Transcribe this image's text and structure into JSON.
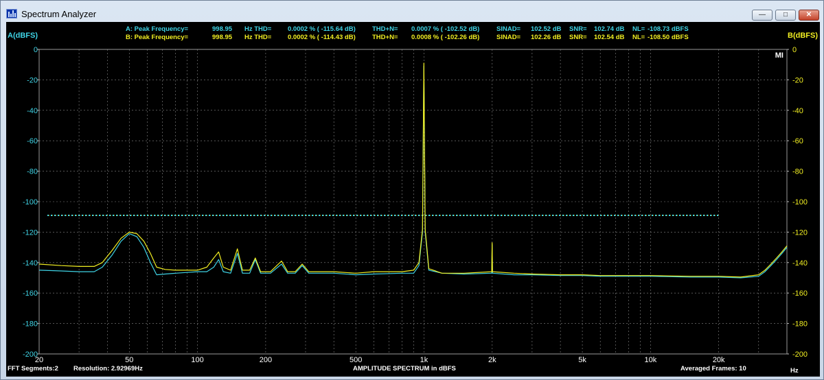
{
  "window": {
    "title": "Spectrum Analyzer"
  },
  "titlebar_buttons": {
    "minimize": "—",
    "restore": "□",
    "close": "✕"
  },
  "colors": {
    "channel_a": "#3fd4e6",
    "channel_b": "#f2ef22",
    "background": "#000000",
    "grid": "#8a8a8a"
  },
  "header": {
    "a": {
      "label": "A: Peak Frequency=",
      "freq": "998.95",
      "thd_label": "Hz  THD=",
      "thd": "0.0002 % ( -115.64 dB)",
      "thdn_label": "THD+N=",
      "thdn": "0.0007 % ( -102.52 dB)",
      "sinad_label": "SINAD=",
      "sinad": "102.52 dB",
      "snr_label": "SNR=",
      "snr": "102.74 dB",
      "nl_label": "NL=",
      "nl": "-108.73 dBFS"
    },
    "b": {
      "label": "B: Peak Frequency=",
      "freq": "998.95",
      "thd_label": "Hz  THD=",
      "thd": "0.0002 % ( -114.43 dB)",
      "thdn_label": "THD+N=",
      "thdn": "0.0008 % ( -102.26 dB)",
      "sinad_label": "SINAD=",
      "sinad": "102.26 dB",
      "snr_label": "SNR=",
      "snr": "102.54 dB",
      "nl_label": "NL=",
      "nl": "-108.50 dBFS"
    }
  },
  "footer": {
    "segments": "FFT Segments:2",
    "resolution": "Resolution:  2.92969Hz",
    "center": "AMPLITUDE SPECTRUM in dBFS",
    "frames": "Averaged Frames: 10",
    "unit": "Hz"
  },
  "chart_data": {
    "type": "line",
    "title": "AMPLITUDE SPECTRUM in dBFS",
    "xlabel": "Hz",
    "ylabel": "A(dBFS)",
    "ylabel_right": "B(dBFS)",
    "x_scale": "log",
    "xlim": [
      20,
      40000
    ],
    "ylim": [
      -200,
      0
    ],
    "grid": true,
    "corner_label": "MI",
    "x_ticks": [
      {
        "value": 20,
        "label": "20"
      },
      {
        "value": 50,
        "label": "50"
      },
      {
        "value": 100,
        "label": "100"
      },
      {
        "value": 200,
        "label": "200"
      },
      {
        "value": 500,
        "label": "500"
      },
      {
        "value": 1000,
        "label": "1k"
      },
      {
        "value": 2000,
        "label": "2k"
      },
      {
        "value": 5000,
        "label": "5k"
      },
      {
        "value": 10000,
        "label": "10k"
      },
      {
        "value": 20000,
        "label": "20k"
      }
    ],
    "y_ticks": [
      0,
      -20,
      -40,
      -60,
      -80,
      -100,
      -120,
      -140,
      -160,
      -180,
      -200
    ],
    "noise_level_line": {
      "value": -109,
      "xrange": [
        20,
        20000
      ]
    },
    "series": [
      {
        "channel": "A",
        "color": "#3fd4e6",
        "points": [
          [
            20,
            -145
          ],
          [
            25,
            -145.5
          ],
          [
            30,
            -146
          ],
          [
            35,
            -146
          ],
          [
            38,
            -143
          ],
          [
            42,
            -135
          ],
          [
            46,
            -126
          ],
          [
            50,
            -121
          ],
          [
            54,
            -123
          ],
          [
            58,
            -130
          ],
          [
            62,
            -140
          ],
          [
            66,
            -148
          ],
          [
            72,
            -147.5
          ],
          [
            80,
            -147
          ],
          [
            90,
            -146.5
          ],
          [
            100,
            -146
          ],
          [
            110,
            -146
          ],
          [
            118,
            -143
          ],
          [
            124,
            -138
          ],
          [
            130,
            -146
          ],
          [
            140,
            -147
          ],
          [
            150,
            -134
          ],
          [
            158,
            -147
          ],
          [
            170,
            -147
          ],
          [
            180,
            -138
          ],
          [
            190,
            -147
          ],
          [
            210,
            -147
          ],
          [
            235,
            -141
          ],
          [
            250,
            -147
          ],
          [
            270,
            -147
          ],
          [
            290,
            -142
          ],
          [
            310,
            -147
          ],
          [
            400,
            -147
          ],
          [
            500,
            -148
          ],
          [
            600,
            -147.5
          ],
          [
            800,
            -147
          ],
          [
            900,
            -147
          ],
          [
            950,
            -142
          ],
          [
            985,
            -120
          ],
          [
            998.95,
            -11
          ],
          [
            1012,
            -120
          ],
          [
            1050,
            -145
          ],
          [
            1200,
            -147
          ],
          [
            1500,
            -147.5
          ],
          [
            1990,
            -147
          ],
          [
            1998,
            -128
          ],
          [
            2006,
            -147
          ],
          [
            2500,
            -148
          ],
          [
            3000,
            -148
          ],
          [
            4000,
            -148.5
          ],
          [
            5000,
            -148.5
          ],
          [
            6000,
            -149
          ],
          [
            8000,
            -149
          ],
          [
            10000,
            -149
          ],
          [
            15000,
            -149.5
          ],
          [
            20000,
            -149.5
          ],
          [
            25000,
            -150
          ],
          [
            30000,
            -149
          ],
          [
            32000,
            -146
          ],
          [
            34000,
            -142
          ],
          [
            36000,
            -138
          ],
          [
            38000,
            -134
          ],
          [
            40000,
            -130
          ]
        ]
      },
      {
        "channel": "B",
        "color": "#f2ef22",
        "points": [
          [
            20,
            -141
          ],
          [
            25,
            -142
          ],
          [
            30,
            -142.5
          ],
          [
            35,
            -142.5
          ],
          [
            38,
            -140
          ],
          [
            42,
            -132
          ],
          [
            46,
            -124
          ],
          [
            50,
            -120
          ],
          [
            54,
            -121
          ],
          [
            58,
            -126
          ],
          [
            62,
            -134
          ],
          [
            66,
            -143
          ],
          [
            72,
            -144.5
          ],
          [
            80,
            -145
          ],
          [
            90,
            -145
          ],
          [
            100,
            -145
          ],
          [
            110,
            -143
          ],
          [
            118,
            -137
          ],
          [
            124,
            -133
          ],
          [
            130,
            -143
          ],
          [
            140,
            -145
          ],
          [
            150,
            -131
          ],
          [
            158,
            -145
          ],
          [
            170,
            -145
          ],
          [
            180,
            -137
          ],
          [
            190,
            -146
          ],
          [
            210,
            -146
          ],
          [
            235,
            -139
          ],
          [
            250,
            -146
          ],
          [
            270,
            -146
          ],
          [
            290,
            -141
          ],
          [
            310,
            -146
          ],
          [
            400,
            -146
          ],
          [
            500,
            -147
          ],
          [
            600,
            -146
          ],
          [
            800,
            -146
          ],
          [
            900,
            -145
          ],
          [
            950,
            -140
          ],
          [
            985,
            -118
          ],
          [
            998.95,
            -9
          ],
          [
            1012,
            -118
          ],
          [
            1050,
            -144
          ],
          [
            1200,
            -147
          ],
          [
            1500,
            -147
          ],
          [
            1990,
            -146
          ],
          [
            1998,
            -127
          ],
          [
            2006,
            -146
          ],
          [
            2500,
            -147
          ],
          [
            3000,
            -147.5
          ],
          [
            4000,
            -148
          ],
          [
            5000,
            -148
          ],
          [
            6000,
            -148.5
          ],
          [
            8000,
            -148.5
          ],
          [
            10000,
            -148.5
          ],
          [
            15000,
            -149
          ],
          [
            20000,
            -149
          ],
          [
            25000,
            -149.5
          ],
          [
            30000,
            -148
          ],
          [
            32000,
            -145
          ],
          [
            34000,
            -141
          ],
          [
            36000,
            -137
          ],
          [
            38000,
            -133
          ],
          [
            40000,
            -129
          ]
        ]
      }
    ]
  }
}
